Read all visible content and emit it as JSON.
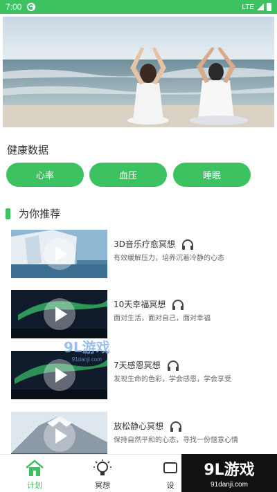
{
  "status_bar": {
    "time": "7:00",
    "network": "LTE"
  },
  "health": {
    "title": "健康数据",
    "buttons": [
      {
        "label": "心率"
      },
      {
        "label": "血压"
      },
      {
        "label": "睡眠"
      }
    ]
  },
  "recommend": {
    "title": "为你推荐",
    "items": [
      {
        "title": "3D音乐疗愈冥想",
        "desc": "有效缓解压力，培养沉着冷静的心态"
      },
      {
        "title": "10天幸福冥想",
        "desc": "面对生活，面对自己，面对幸福"
      },
      {
        "title": "7天感恩冥想",
        "desc": "发现生命的色彩，学会感恩，学会享受"
      },
      {
        "title": "放松静心冥想",
        "desc": "保持自然平和的心态，寻找一份惬意心情"
      }
    ]
  },
  "tabbar": {
    "tabs": [
      {
        "label": "计划"
      },
      {
        "label": "冥想"
      },
      {
        "label": "设"
      }
    ],
    "active_index": 0
  },
  "watermark": {
    "logo": "9L游戏",
    "url": "91danji.com"
  },
  "colors": {
    "accent": "#3cc260"
  }
}
